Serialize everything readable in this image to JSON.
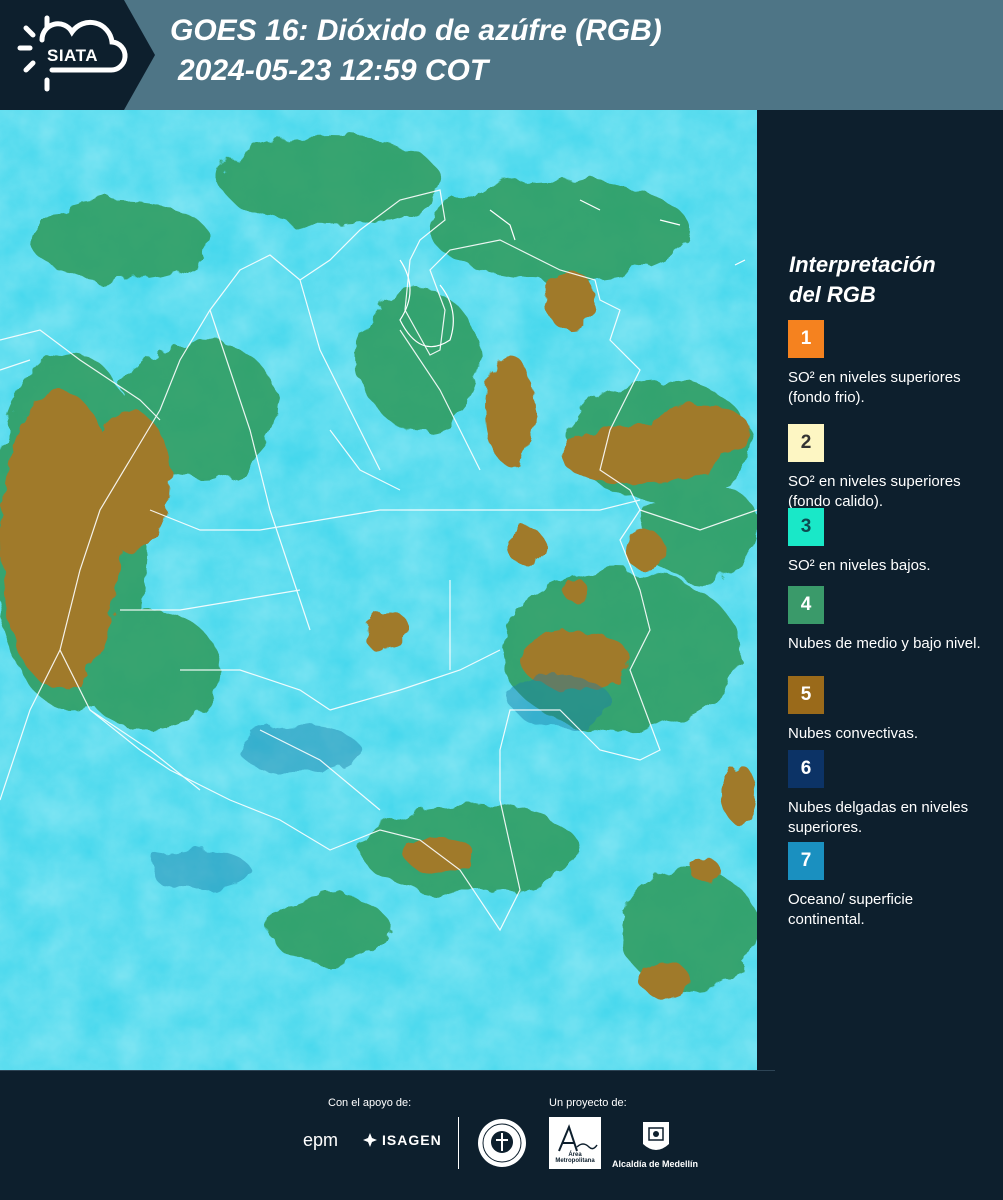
{
  "header": {
    "logo_text": "SIATA",
    "title_line1": "GOES 16: Dióxido de azúfre (RGB)",
    "title_line2": "2024-05-23 12:59 COT"
  },
  "legend": {
    "title_line1": "Interpretación",
    "title_line2": "del RGB",
    "items": [
      {
        "number": "1",
        "label": "SO² en niveles superiores (fondo frio).",
        "color": "#f5821f",
        "text_color": "#ffffff"
      },
      {
        "number": "2",
        "label": "SO² en niveles superiores (fondo calido).",
        "color": "#fdf6c3",
        "text_color": "#333333"
      },
      {
        "number": "3",
        "label": "SO² en niveles bajos.",
        "color": "#19e8c8",
        "text_color": "#0d4a50"
      },
      {
        "number": "4",
        "label": "Nubes de medio y bajo nivel.",
        "color": "#3a9a6a",
        "text_color": "#ffffff"
      },
      {
        "number": "5",
        "label": "Nubes convectivas.",
        "color": "#9a6a1a",
        "text_color": "#ffffff"
      },
      {
        "number": "6",
        "label": "Nubes delgadas en niveles superiores.",
        "color": "#0c3366",
        "text_color": "#ffffff"
      },
      {
        "number": "7",
        "label": "Oceano/ superficie continental.",
        "color": "#1a90c0",
        "text_color": "#ffffff"
      }
    ]
  },
  "footer": {
    "support_label": "Con el apoyo de:",
    "project_label": "Un proyecto de:",
    "epm": "epm",
    "isagen": "ISAGEN",
    "area_text": "Área Metropolitana",
    "alcaldia": "Alcaldía de Medellín"
  },
  "colors": {
    "background": "#0d1f2d",
    "header_band": "#4e7586",
    "map_base": "#3fd6ec",
    "cloud_brown": "#a07a2a",
    "cloud_green": "#2f9a5a"
  }
}
